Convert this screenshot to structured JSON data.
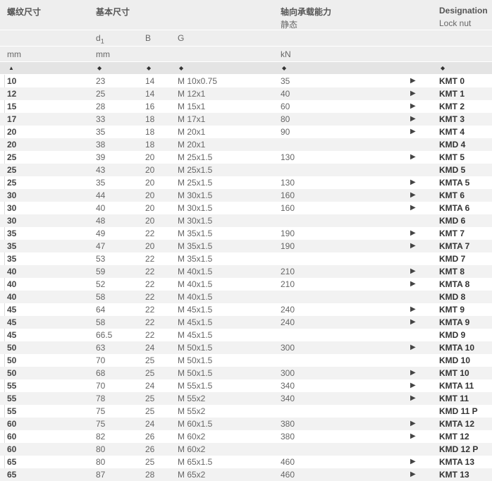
{
  "header": {
    "col_thread": "螺纹尺寸",
    "col_basic": "基本尺寸",
    "col_axial": "轴向承载能力",
    "col_axial_sub": "静态",
    "col_designation": "Designation",
    "col_designation_sub": "Lock nut",
    "d1_label": "d",
    "d1_sub": "1",
    "b_label": "B",
    "g_label": "G",
    "unit_mm_1": "mm",
    "unit_mm_2": "mm",
    "unit_kn": "kN",
    "sort_active": "▲",
    "sort_inactive": "◆"
  },
  "rows": [
    {
      "size": "10",
      "d1": "23",
      "b": "14",
      "g": "M 10x0.75",
      "kn": "35",
      "arrow": "▶",
      "desig": "KMT 0"
    },
    {
      "size": "12",
      "d1": "25",
      "b": "14",
      "g": "M 12x1",
      "kn": "40",
      "arrow": "▶",
      "desig": "KMT 1"
    },
    {
      "size": "15",
      "d1": "28",
      "b": "16",
      "g": "M 15x1",
      "kn": "60",
      "arrow": "▶",
      "desig": "KMT 2"
    },
    {
      "size": "17",
      "d1": "33",
      "b": "18",
      "g": "M 17x1",
      "kn": "80",
      "arrow": "▶",
      "desig": "KMT 3"
    },
    {
      "size": "20",
      "d1": "35",
      "b": "18",
      "g": "M 20x1",
      "kn": "90",
      "arrow": "▶",
      "desig": "KMT 4"
    },
    {
      "size": "20",
      "d1": "38",
      "b": "18",
      "g": "M 20x1",
      "kn": "",
      "arrow": "",
      "desig": "KMD 4"
    },
    {
      "size": "25",
      "d1": "39",
      "b": "20",
      "g": "M 25x1.5",
      "kn": "130",
      "arrow": "▶",
      "desig": "KMT 5"
    },
    {
      "size": "25",
      "d1": "43",
      "b": "20",
      "g": "M 25x1.5",
      "kn": "",
      "arrow": "",
      "desig": "KMD 5"
    },
    {
      "size": "25",
      "d1": "35",
      "b": "20",
      "g": "M 25x1.5",
      "kn": "130",
      "arrow": "▶",
      "desig": "KMTA 5"
    },
    {
      "size": "30",
      "d1": "44",
      "b": "20",
      "g": "M 30x1.5",
      "kn": "160",
      "arrow": "▶",
      "desig": "KMT 6"
    },
    {
      "size": "30",
      "d1": "40",
      "b": "20",
      "g": "M 30x1.5",
      "kn": "160",
      "arrow": "▶",
      "desig": "KMTA 6"
    },
    {
      "size": "30",
      "d1": "48",
      "b": "20",
      "g": "M 30x1.5",
      "kn": "",
      "arrow": "",
      "desig": "KMD 6"
    },
    {
      "size": "35",
      "d1": "49",
      "b": "22",
      "g": "M 35x1.5",
      "kn": "190",
      "arrow": "▶",
      "desig": "KMT 7"
    },
    {
      "size": "35",
      "d1": "47",
      "b": "20",
      "g": "M 35x1.5",
      "kn": "190",
      "arrow": "▶",
      "desig": "KMTA 7"
    },
    {
      "size": "35",
      "d1": "53",
      "b": "22",
      "g": "M 35x1.5",
      "kn": "",
      "arrow": "",
      "desig": "KMD 7"
    },
    {
      "size": "40",
      "d1": "59",
      "b": "22",
      "g": "M 40x1.5",
      "kn": "210",
      "arrow": "▶",
      "desig": "KMT 8"
    },
    {
      "size": "40",
      "d1": "52",
      "b": "22",
      "g": "M 40x1.5",
      "kn": "210",
      "arrow": "▶",
      "desig": "KMTA 8"
    },
    {
      "size": "40",
      "d1": "58",
      "b": "22",
      "g": "M 40x1.5",
      "kn": "",
      "arrow": "",
      "desig": "KMD 8"
    },
    {
      "size": "45",
      "d1": "64",
      "b": "22",
      "g": "M 45x1.5",
      "kn": "240",
      "arrow": "▶",
      "desig": "KMT 9"
    },
    {
      "size": "45",
      "d1": "58",
      "b": "22",
      "g": "M 45x1.5",
      "kn": "240",
      "arrow": "▶",
      "desig": "KMTA 9"
    },
    {
      "size": "45",
      "d1": "66.5",
      "b": "22",
      "g": "M 45x1.5",
      "kn": "",
      "arrow": "",
      "desig": "KMD 9"
    },
    {
      "size": "50",
      "d1": "63",
      "b": "24",
      "g": "M 50x1.5",
      "kn": "300",
      "arrow": "▶",
      "desig": "KMTA 10"
    },
    {
      "size": "50",
      "d1": "70",
      "b": "25",
      "g": "M 50x1.5",
      "kn": "",
      "arrow": "",
      "desig": "KMD 10"
    },
    {
      "size": "50",
      "d1": "68",
      "b": "25",
      "g": "M 50x1.5",
      "kn": "300",
      "arrow": "▶",
      "desig": "KMT 10"
    },
    {
      "size": "55",
      "d1": "70",
      "b": "24",
      "g": "M 55x1.5",
      "kn": "340",
      "arrow": "▶",
      "desig": "KMTA 11"
    },
    {
      "size": "55",
      "d1": "78",
      "b": "25",
      "g": "M 55x2",
      "kn": "340",
      "arrow": "▶",
      "desig": "KMT 11"
    },
    {
      "size": "55",
      "d1": "75",
      "b": "25",
      "g": "M 55x2",
      "kn": "",
      "arrow": "",
      "desig": "KMD 11 P"
    },
    {
      "size": "60",
      "d1": "75",
      "b": "24",
      "g": "M 60x1.5",
      "kn": "380",
      "arrow": "▶",
      "desig": "KMTA 12"
    },
    {
      "size": "60",
      "d1": "82",
      "b": "26",
      "g": "M 60x2",
      "kn": "380",
      "arrow": "▶",
      "desig": "KMT 12"
    },
    {
      "size": "60",
      "d1": "80",
      "b": "26",
      "g": "M 60x2",
      "kn": "",
      "arrow": "",
      "desig": "KMD 12 P"
    },
    {
      "size": "65",
      "d1": "80",
      "b": "25",
      "g": "M 65x1.5",
      "kn": "460",
      "arrow": "▶",
      "desig": "KMTA 13"
    },
    {
      "size": "65",
      "d1": "87",
      "b": "28",
      "g": "M 65x2",
      "kn": "460",
      "arrow": "▶",
      "desig": "KMT 13"
    }
  ]
}
